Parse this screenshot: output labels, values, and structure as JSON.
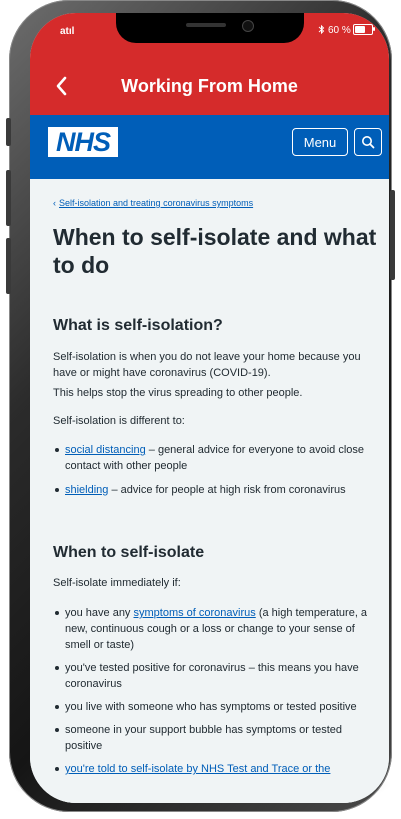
{
  "status_bar": {
    "signal": "atıl",
    "battery": "60 %",
    "battery_level": 0.6,
    "bluetooth_icon": "bluetooth-icon"
  },
  "app_bar": {
    "title": "Working From Home",
    "back_icon": "chevron-left-icon",
    "color": "#d52b2b"
  },
  "nhs_header": {
    "logo": "NHS",
    "menu_label": "Menu",
    "search_icon": "search-icon",
    "color": "#005eb8"
  },
  "article": {
    "breadcrumb": "Self-isolation and treating coronavirus symptoms",
    "title": "When to self-isolate and what to do",
    "section1": {
      "heading": "What is self-isolation?",
      "p1": "Self-isolation is when you do not leave your home because you have or might have coronavirus (COVID-19).",
      "p2": "This helps stop the virus spreading to other people.",
      "p3": "Self-isolation is different to:",
      "bullets": [
        {
          "link": "social distancing",
          "text": " – general advice for everyone to avoid close contact with other people"
        },
        {
          "link": "shielding",
          "text": " – advice for people at high risk from coronavirus"
        }
      ]
    },
    "section2": {
      "heading": "When to self-isolate",
      "intro": "Self-isolate immediately if:",
      "bullets": [
        {
          "pre": "you have any ",
          "link": "symptoms of coronavirus",
          "post": " (a high temperature, a new, continuous cough or a loss or change to your sense of smell or taste)"
        },
        {
          "text": "you've tested positive for coronavirus – this means you have coronavirus"
        },
        {
          "text": "you live with someone who has symptoms or tested positive"
        },
        {
          "text": "someone in your support bubble has symptoms or tested positive"
        },
        {
          "link": "you're told to self-isolate by NHS Test and Trace or the"
        }
      ]
    }
  }
}
